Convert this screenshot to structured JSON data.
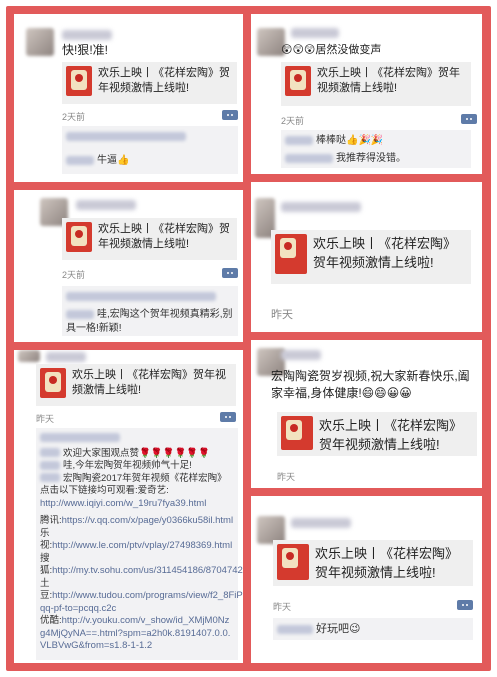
{
  "panels": {
    "p1": {
      "post_text": "快!狠!准!",
      "share_title": "欢乐上映丨《花样宏陶》贺年视频激情上线啦!",
      "time": "2天前",
      "comment_1": "牛逼👍"
    },
    "p2": {
      "post_text": "😲😲😲居然没做变声",
      "share_title": "欢乐上映丨《花样宏陶》贺年视频激情上线啦!",
      "time": "2天前",
      "comment_1": "棒棒哒👍🎉🎉",
      "comment_2": "我推荐得没错。"
    },
    "p3": {
      "share_title": "欢乐上映丨《花样宏陶》贺年视频激情上线啦!",
      "time": "2天前",
      "comment_1": "哇,宏陶这个贺年视频真精彩,别具一格!新颖!"
    },
    "p4": {
      "share_title": "欢乐上映丨《花样宏陶》贺年视频激情上线啦!",
      "time": "昨天"
    },
    "p5": {
      "share_title": "欢乐上映丨《花样宏陶》贺年视频激情上线啦!",
      "time": "昨天",
      "c1": "欢迎大家围观点赞🌹🌹🌹🌹🌹🌹",
      "c2": "哇,今年宏陶贺年视频帅气十足!",
      "c3": "宏陶陶瓷2017年贺年视频《花样宏陶》点击以下链接均可观看:爱奇艺:",
      "iqiyi": "http://www.iqiyi.com/w_19ru7fya39.html",
      "tencent_label": "腾讯:",
      "tencent": "https://v.qq.com/x/page/y0366ku58il.html",
      "letv_label": "乐视:",
      "letv": "http://www.le.com/ptv/vplay/27498369.html",
      "sohu_label": "搜狐:",
      "sohu": "http://my.tv.sohu.com/us/311454186/87047428.shtml",
      "tudou_label": "土豆:",
      "tudou": "http://www.tudou.com/programs/view/f2_8FiPdMkU/?qq-pf-to=pcqq.c2c",
      "youku_label": "优酷:",
      "youku": "http://v.youku.com/v_show/id_XMjM0Nzg4MjQyNA==.html?spm=a2h0k.8191407.0.0.VLBVwG&from=s1.8-1-1.2"
    },
    "p6": {
      "post_text": "宏陶陶瓷贺岁视频,祝大家新春快乐,阖家幸福,身体健康!😄😄😀😀",
      "share_title": "欢乐上映丨《花样宏陶》贺年视频激情上线啦!",
      "time": "昨天"
    },
    "p7": {
      "share_title": "欢乐上映丨《花样宏陶》贺年视频激情上线啦!",
      "time": "昨天",
      "comment_1": "好玩吧😉"
    }
  }
}
